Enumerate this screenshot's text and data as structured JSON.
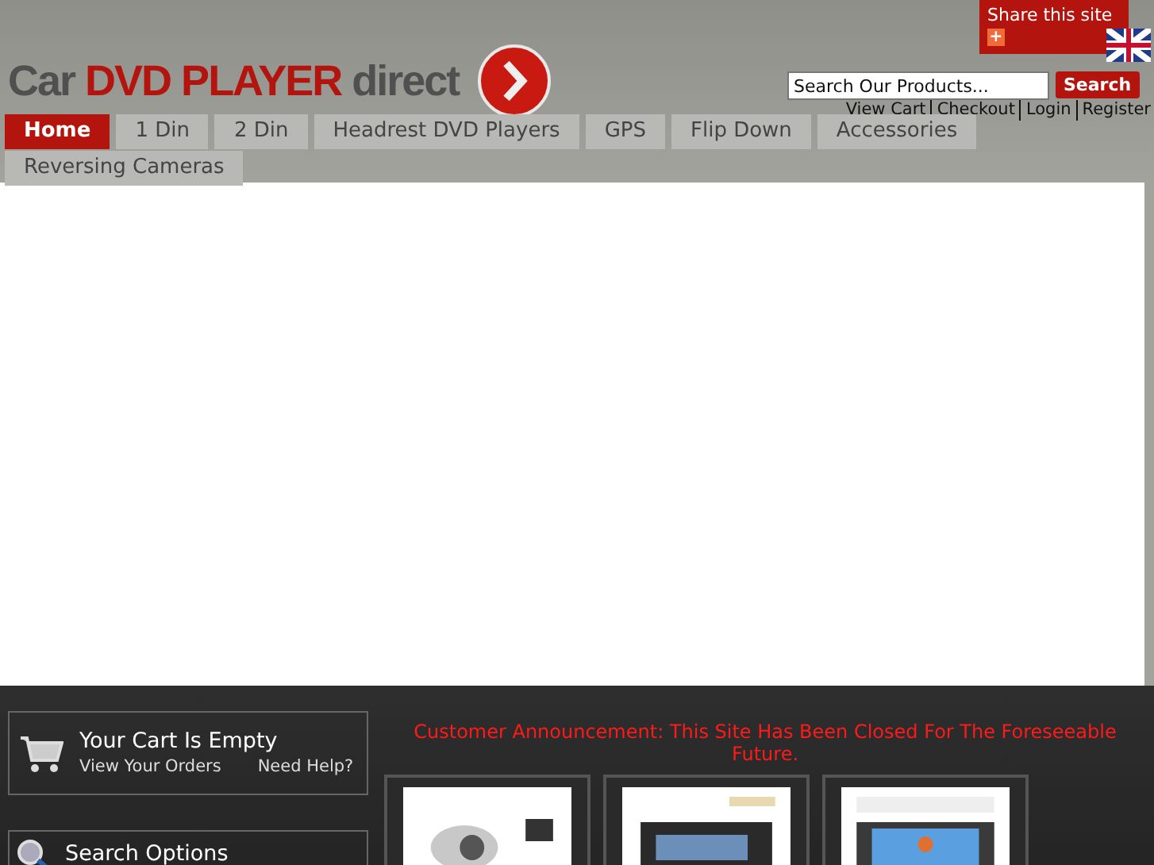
{
  "share": {
    "label": "Share this site",
    "icon": "+"
  },
  "logo": {
    "part_1": "Car",
    "part_2": "DVD PLAYER",
    "part_3": "direct"
  },
  "search": {
    "placeholder": "Search Our Products...",
    "button": "Search"
  },
  "account_links": [
    "View Cart",
    "Checkout",
    "Login",
    "Register"
  ],
  "nav": [
    {
      "label": "Home",
      "selected": true
    },
    {
      "label": "1 Din",
      "selected": false
    },
    {
      "label": "2 Din",
      "selected": false
    },
    {
      "label": "Headrest DVD Players",
      "selected": false
    },
    {
      "label": "GPS",
      "selected": false
    },
    {
      "label": "Flip Down",
      "selected": false
    },
    {
      "label": "Accessories",
      "selected": false
    },
    {
      "label": "Reversing Cameras",
      "selected": false
    }
  ],
  "cart": {
    "title": "Your Cart Is Empty",
    "links": [
      "View Your Orders",
      "Need Help?"
    ]
  },
  "search_options": {
    "title": "Search Options"
  },
  "announcement": "Customer Announcement: This Site Has Been Closed For The Foreseeable Future."
}
